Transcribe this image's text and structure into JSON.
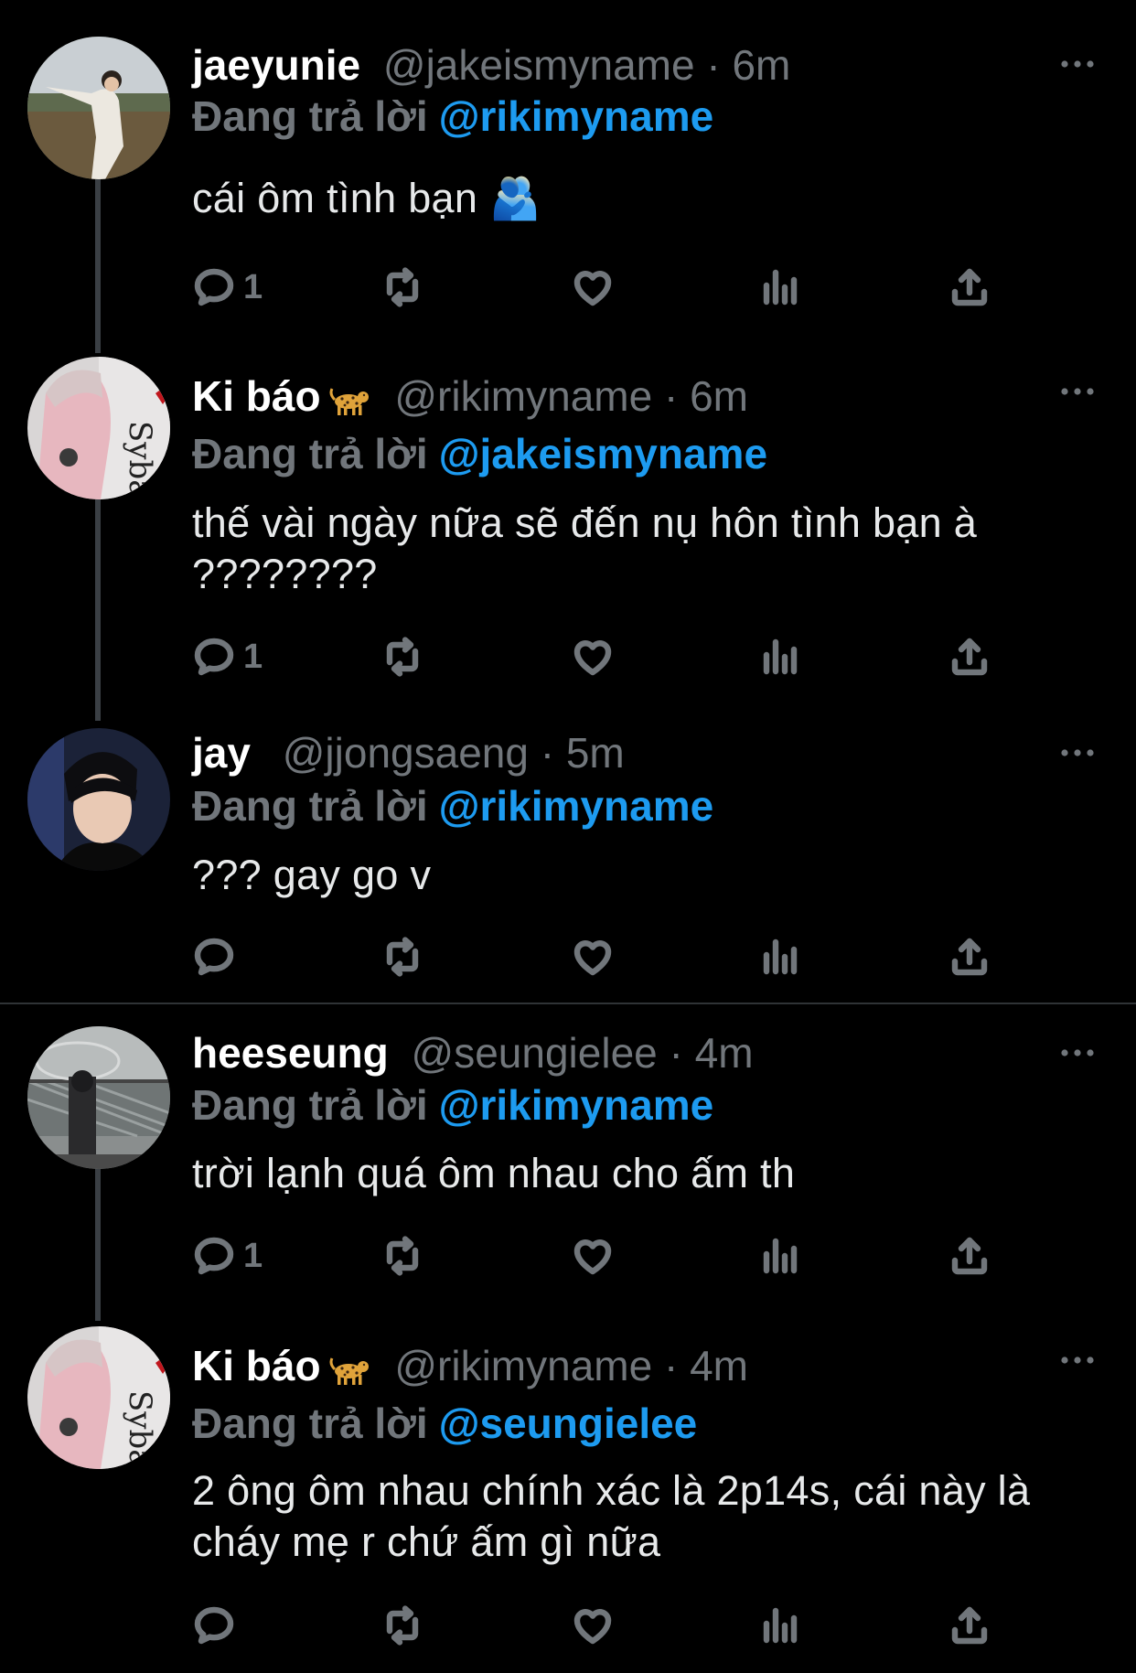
{
  "tweets": [
    {
      "name": "jaeyunie",
      "name_emoji": "",
      "handle": "@jakeismyname",
      "time": "6m",
      "replying_label": "Đang trả lời",
      "replying_to": "@rikimyname",
      "text": "cái ôm tình bạn 🫂",
      "reply_count": "1"
    },
    {
      "name": "Ki báo",
      "name_emoji": "leopard-icon",
      "handle": "@rikimyname",
      "time": "6m",
      "replying_label": "Đang trả lời",
      "replying_to": "@jakeismyname",
      "text": "thế vài ngày nữa sẽ đến nụ hôn tình bạn à ????????",
      "reply_count": "1"
    },
    {
      "name": "jay",
      "name_emoji": "",
      "handle": "@jjongsaeng",
      "time": "5m",
      "replying_label": "Đang trả lời",
      "replying_to": "@rikimyname",
      "text": "??? gay go v",
      "reply_count": ""
    },
    {
      "name": "heeseung",
      "name_emoji": "",
      "handle": "@seungielee",
      "time": "4m",
      "replying_label": "Đang trả lời",
      "replying_to": "@rikimyname",
      "text": "trời lạnh quá ôm nhau cho ấm th",
      "reply_count": "1"
    },
    {
      "name": "Ki báo",
      "name_emoji": "leopard-icon",
      "handle": "@rikimyname",
      "time": "4m",
      "replying_label": "Đang trả lời",
      "replying_to": "@seungielee",
      "text": "2 ông ôm nhau chính xác là 2p14s, cái này là cháy mẹ r chứ ấm gì nữa",
      "reply_count": ""
    }
  ],
  "separator": "·",
  "colors": {
    "background": "#000000",
    "text": "#e7e9ea",
    "muted": "#71767b",
    "link": "#1d9bf0",
    "thread_line": "#3a3f44"
  }
}
